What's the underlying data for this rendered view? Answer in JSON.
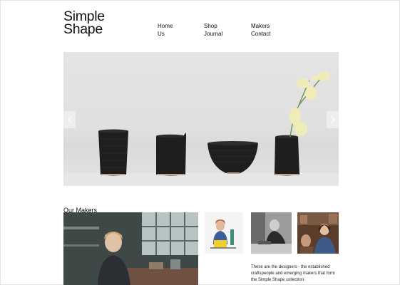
{
  "brand": {
    "line1": "Simple",
    "line2": "Shape"
  },
  "nav": {
    "col1": [
      "Home",
      "Us"
    ],
    "col2": [
      "Shop",
      "Journal"
    ],
    "col3": [
      "Makers",
      "Contact"
    ]
  },
  "hero": {
    "prev_icon": "chevron-left-icon",
    "next_icon": "chevron-right-icon",
    "pot_color": "#1f1e1d",
    "flower_color": "#f0ecb8"
  },
  "makers": {
    "title": "Our Makers",
    "description": "These are the designers - the established craftspeople and emerging makers that form the Simple Shape collection."
  }
}
